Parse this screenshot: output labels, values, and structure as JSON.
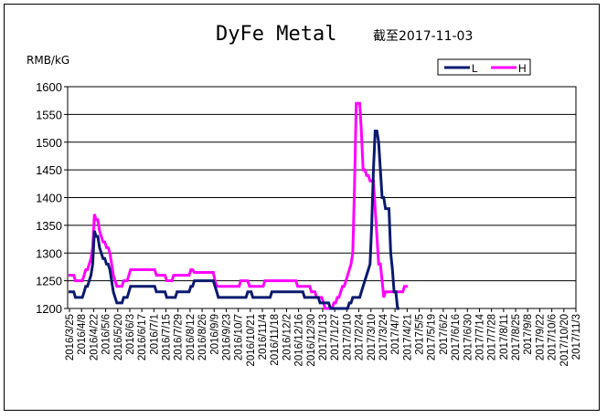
{
  "chart_data": {
    "type": "line",
    "title": "DyFe Metal",
    "subtitle": "截至2017-11-03",
    "ylabel": "RMB/kG",
    "xlabel": "",
    "ylim": [
      1200,
      1600
    ],
    "yticks": [
      1200,
      1250,
      1300,
      1350,
      1400,
      1450,
      1500,
      1550,
      1600
    ],
    "grid": true,
    "legend": "top-right",
    "colors": {
      "L": "#0a1a6e",
      "H": "#ff00ff"
    },
    "categories": [
      "2016/3/25",
      "2016/4/8",
      "2016/4/22",
      "2016/5/6",
      "2016/5/20",
      "2016/6/3",
      "2016/6/17",
      "2016/7/1",
      "2016/7/15",
      "2016/7/29",
      "2016/8/12",
      "2016/8/26",
      "2016/9/9",
      "2016/9/23",
      "2016/10/7",
      "2016/10/21",
      "2016/11/4",
      "2016/11/18",
      "2016/12/2",
      "2016/12/16",
      "2016/12/30",
      "2017/1/13",
      "2017/1/27",
      "2017/2/10",
      "2017/2/24",
      "2017/3/10",
      "2017/3/24",
      "2017/4/7",
      "2017/4/21",
      "2017/5/5",
      "2017/5/19",
      "2017/6/2",
      "2017/6/16",
      "2017/6/30",
      "2017/7/14",
      "2017/7/28",
      "2017/8/11",
      "2017/8/25",
      "2017/9/8",
      "2017/9/22",
      "2017/10/6",
      "2017/10/20",
      "2017/11/3"
    ],
    "x": [
      0,
      2,
      4,
      6,
      8,
      10,
      12,
      14,
      16,
      18,
      20,
      22,
      24,
      26,
      28,
      30,
      32,
      34,
      36,
      38,
      40,
      42,
      44,
      46,
      48,
      50,
      52,
      54,
      56,
      58,
      60,
      62,
      64,
      66,
      68,
      70,
      72,
      74,
      76,
      78,
      80,
      82,
      84,
      86,
      88,
      90,
      92,
      94,
      96,
      98,
      100,
      102,
      104,
      106,
      108,
      110,
      112,
      114,
      116,
      118,
      120,
      122,
      124,
      126,
      128,
      130,
      132,
      134,
      136,
      138,
      140,
      142,
      144,
      146,
      148,
      150,
      152,
      154,
      156,
      158,
      160,
      162,
      164,
      166,
      168,
      170,
      172,
      174,
      176,
      178,
      180,
      182,
      184,
      186,
      188,
      190,
      192,
      194,
      196,
      198,
      200,
      202,
      204,
      206,
      208,
      210,
      212,
      214,
      216,
      218,
      220,
      222,
      224,
      226,
      228,
      230,
      232,
      234,
      236,
      238,
      240,
      242,
      244,
      246,
      248,
      250,
      252,
      254,
      256,
      258,
      260,
      262,
      264,
      266,
      268,
      270,
      272,
      274,
      276,
      278,
      280,
      282,
      284,
      286,
      288,
      290,
      292,
      294,
      296,
      298,
      300,
      302,
      304,
      306,
      308,
      310,
      312,
      314,
      316,
      318,
      320,
      322,
      324,
      326,
      328,
      330,
      332,
      334,
      336,
      338,
      340,
      342,
      344,
      346,
      348,
      350,
      352,
      354,
      356,
      358,
      360,
      362,
      364,
      366,
      368,
      370,
      372,
      374,
      376,
      378,
      380,
      382,
      384,
      386,
      388,
      390,
      392,
      394,
      396,
      398,
      400,
      402,
      404,
      406,
      408,
      410,
      412,
      414,
      416,
      418,
      420,
      422,
      424,
      426,
      428,
      430,
      432,
      434,
      436,
      438,
      440,
      442,
      444,
      446,
      448,
      450,
      452,
      454,
      456,
      458,
      460,
      462,
      464,
      466,
      468,
      470,
      472,
      474,
      476,
      478,
      480,
      482,
      484,
      486,
      488,
      490,
      492,
      494,
      496,
      498,
      500,
      502,
      504,
      506,
      508,
      510,
      512,
      514,
      516,
      518,
      520,
      522,
      524,
      526,
      528,
      530,
      532,
      534,
      536,
      538,
      540,
      542,
      544,
      546,
      548,
      550,
      552,
      554,
      556,
      558,
      560,
      562,
      564,
      566,
      568,
      570,
      572,
      574,
      576,
      578,
      580,
      582,
      584,
      586,
      588
    ],
    "series": [
      {
        "name": "L",
        "values": [
          1230,
          1230,
          1230,
          1230,
          1220,
          1220,
          1220,
          1220,
          1220,
          1230,
          1240,
          1240,
          1250,
          1260,
          1280,
          1340,
          1330,
          1330,
          1310,
          1300,
          1290,
          1290,
          1280,
          1280,
          1270,
          1250,
          1230,
          1220,
          1210,
          1210,
          1210,
          1210,
          1220,
          1220,
          1220,
          1230,
          1240,
          1240,
          1240,
          1240,
          1240,
          1240,
          1240,
          1240,
          1240,
          1240,
          1240,
          1240,
          1240,
          1240,
          1240,
          1230,
          1230,
          1230,
          1230,
          1230,
          1230,
          1220,
          1220,
          1220,
          1220,
          1220,
          1220,
          1230,
          1230,
          1230,
          1230,
          1230,
          1230,
          1230,
          1230,
          1240,
          1240,
          1250,
          1250,
          1250,
          1250,
          1250,
          1250,
          1250,
          1250,
          1250,
          1250,
          1250,
          1250,
          1240,
          1230,
          1220,
          1220,
          1220,
          1220,
          1220,
          1220,
          1220,
          1220,
          1220,
          1220,
          1220,
          1220,
          1220,
          1220,
          1220,
          1220,
          1220,
          1230,
          1230,
          1230,
          1220,
          1220,
          1220,
          1220,
          1220,
          1220,
          1220,
          1220,
          1220,
          1220,
          1220,
          1230,
          1230,
          1230,
          1230,
          1230,
          1230,
          1230,
          1230,
          1230,
          1230,
          1230,
          1230,
          1230,
          1230,
          1230,
          1230,
          1230,
          1230,
          1230,
          1220,
          1220,
          1220,
          1220,
          1220,
          1220,
          1220,
          1220,
          1220,
          1210,
          1210,
          1210,
          1210,
          1210,
          1210,
          1200,
          1200,
          1200,
          1200,
          1200,
          1200,
          1200,
          1200,
          1200,
          1200,
          1200,
          1210,
          1210,
          1220,
          1220,
          1220,
          1220,
          1220,
          1230,
          1240,
          1250,
          1260,
          1270,
          1280,
          1350,
          1450,
          1520,
          1520,
          1500,
          1450,
          1400,
          1400,
          1380,
          1380,
          1380,
          1300,
          1270,
          1230,
          1230,
          1200,
          1200
        ]
      },
      {
        "name": "H",
        "values": [
          1260,
          1260,
          1260,
          1260,
          1250,
          1250,
          1250,
          1250,
          1250,
          1260,
          1270,
          1270,
          1280,
          1290,
          1310,
          1370,
          1360,
          1360,
          1340,
          1330,
          1320,
          1320,
          1310,
          1310,
          1300,
          1280,
          1260,
          1250,
          1240,
          1240,
          1240,
          1240,
          1250,
          1250,
          1250,
          1260,
          1270,
          1270,
          1270,
          1270,
          1270,
          1270,
          1270,
          1270,
          1270,
          1270,
          1270,
          1270,
          1270,
          1270,
          1270,
          1260,
          1260,
          1260,
          1260,
          1260,
          1260,
          1250,
          1250,
          1250,
          1250,
          1260,
          1260,
          1260,
          1260,
          1260,
          1260,
          1260,
          1260,
          1260,
          1260,
          1270,
          1270,
          1265,
          1265,
          1265,
          1265,
          1265,
          1265,
          1265,
          1265,
          1265,
          1265,
          1265,
          1265,
          1250,
          1240,
          1240,
          1240,
          1240,
          1240,
          1240,
          1240,
          1240,
          1240,
          1240,
          1240,
          1240,
          1240,
          1240,
          1250,
          1250,
          1250,
          1250,
          1250,
          1240,
          1240,
          1240,
          1240,
          1240,
          1240,
          1240,
          1240,
          1240,
          1250,
          1250,
          1250,
          1250,
          1250,
          1250,
          1250,
          1250,
          1250,
          1250,
          1250,
          1250,
          1250,
          1250,
          1250,
          1250,
          1250,
          1250,
          1250,
          1240,
          1240,
          1240,
          1240,
          1240,
          1240,
          1240,
          1240,
          1230,
          1230,
          1230,
          1220,
          1220,
          1220,
          1220,
          1210,
          1200,
          1200,
          1200,
          1200,
          1200,
          1210,
          1210,
          1220,
          1220,
          1230,
          1240,
          1240,
          1250,
          1260,
          1270,
          1280,
          1300,
          1420,
          1570,
          1570,
          1570,
          1520,
          1450,
          1450,
          1440,
          1440,
          1430,
          1430,
          1430,
          1380,
          1330,
          1280,
          1280,
          1250,
          1220,
          1230,
          1230,
          1230,
          1230,
          1230,
          1230,
          1230,
          1230,
          1230,
          1230,
          1230,
          1240,
          1240,
          1240
        ]
      }
    ]
  }
}
